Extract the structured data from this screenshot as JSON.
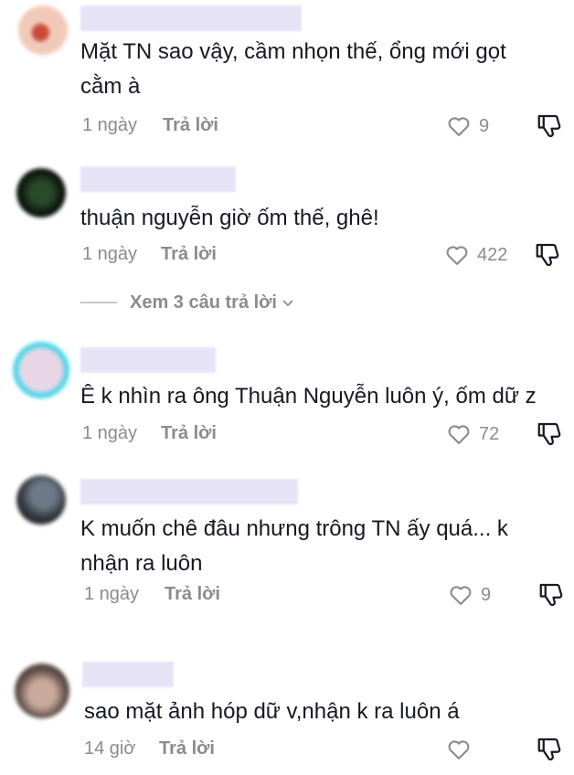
{
  "comments": [
    {
      "text_lines": [
        "Mặt TN sao vậy, cầm nhọn thế, ổng mới gọt",
        "cằm à"
      ],
      "time": "1 ngày",
      "reply": "Trả lời",
      "likes": "9",
      "avatar_colors": [
        "#f1c9b8",
        "#c94b3a"
      ]
    },
    {
      "text_lines": [
        "thuận nguyễn giờ ốm thế, ghê!"
      ],
      "time": "1 ngày",
      "reply": "Trả lời",
      "likes": "422",
      "avatar_colors": [
        "#1e3320",
        "#0c160d"
      ]
    },
    {
      "text_lines": [
        "Ê k nhìn ra ông Thuận Nguyễn luôn ý, ốm dữ z"
      ],
      "time": "1 ngày",
      "reply": "Trả lời",
      "likes": "72",
      "avatar_colors": [
        "#e8d6e6",
        "#4dd6e8"
      ]
    },
    {
      "text_lines": [
        "K muốn chê đâu nhưng trông TN ấy quá... k",
        "nhận ra luôn"
      ],
      "time": "1 ngày",
      "reply": "Trả lời",
      "likes": "9",
      "avatar_colors": [
        "#6b7a86",
        "#2d3238"
      ]
    },
    {
      "text_lines": [
        "sao mặt ảnh hóp dữ v,nhận k ra luôn á"
      ],
      "time": "14 giờ",
      "reply": "Trả lời",
      "likes": "",
      "avatar_colors": [
        "#c9a99b",
        "#5b4a44"
      ]
    }
  ],
  "view_replies": "Xem 3 câu trả lời",
  "icons": {
    "like": "heart-outline-icon",
    "dislike": "thumbs-down-outline-icon",
    "expand": "chevron-down-icon"
  }
}
